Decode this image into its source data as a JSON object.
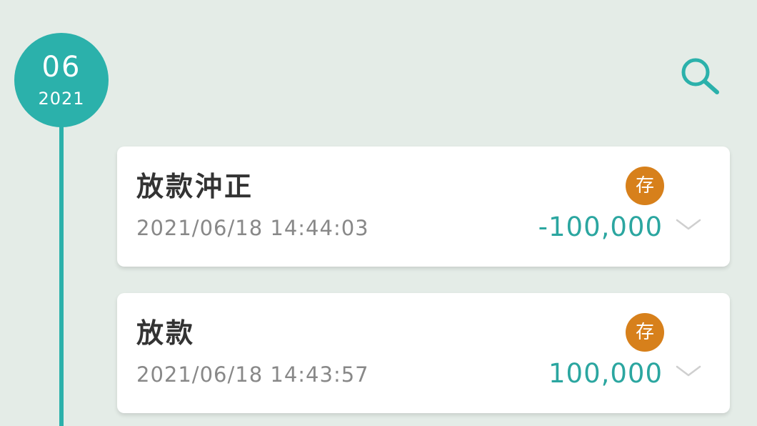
{
  "timeline": {
    "month": "06",
    "year": "2021",
    "accent_color": "#2bb1ab"
  },
  "toolbar": {
    "search_icon": "search-icon"
  },
  "transactions": [
    {
      "title": "放款沖正",
      "datetime": "2021/06/18 14:44:03",
      "badge": "存",
      "amount": "-100,000",
      "expand_icon": "chevron-down-icon"
    },
    {
      "title": "放款",
      "datetime": "2021/06/18 14:43:57",
      "badge": "存",
      "amount": "100,000",
      "expand_icon": "chevron-down-icon"
    }
  ],
  "colors": {
    "background": "#e4ece7",
    "badge": "#d7801b",
    "amount": "#2ba6a0",
    "title": "#333333",
    "timestamp": "#888888"
  }
}
